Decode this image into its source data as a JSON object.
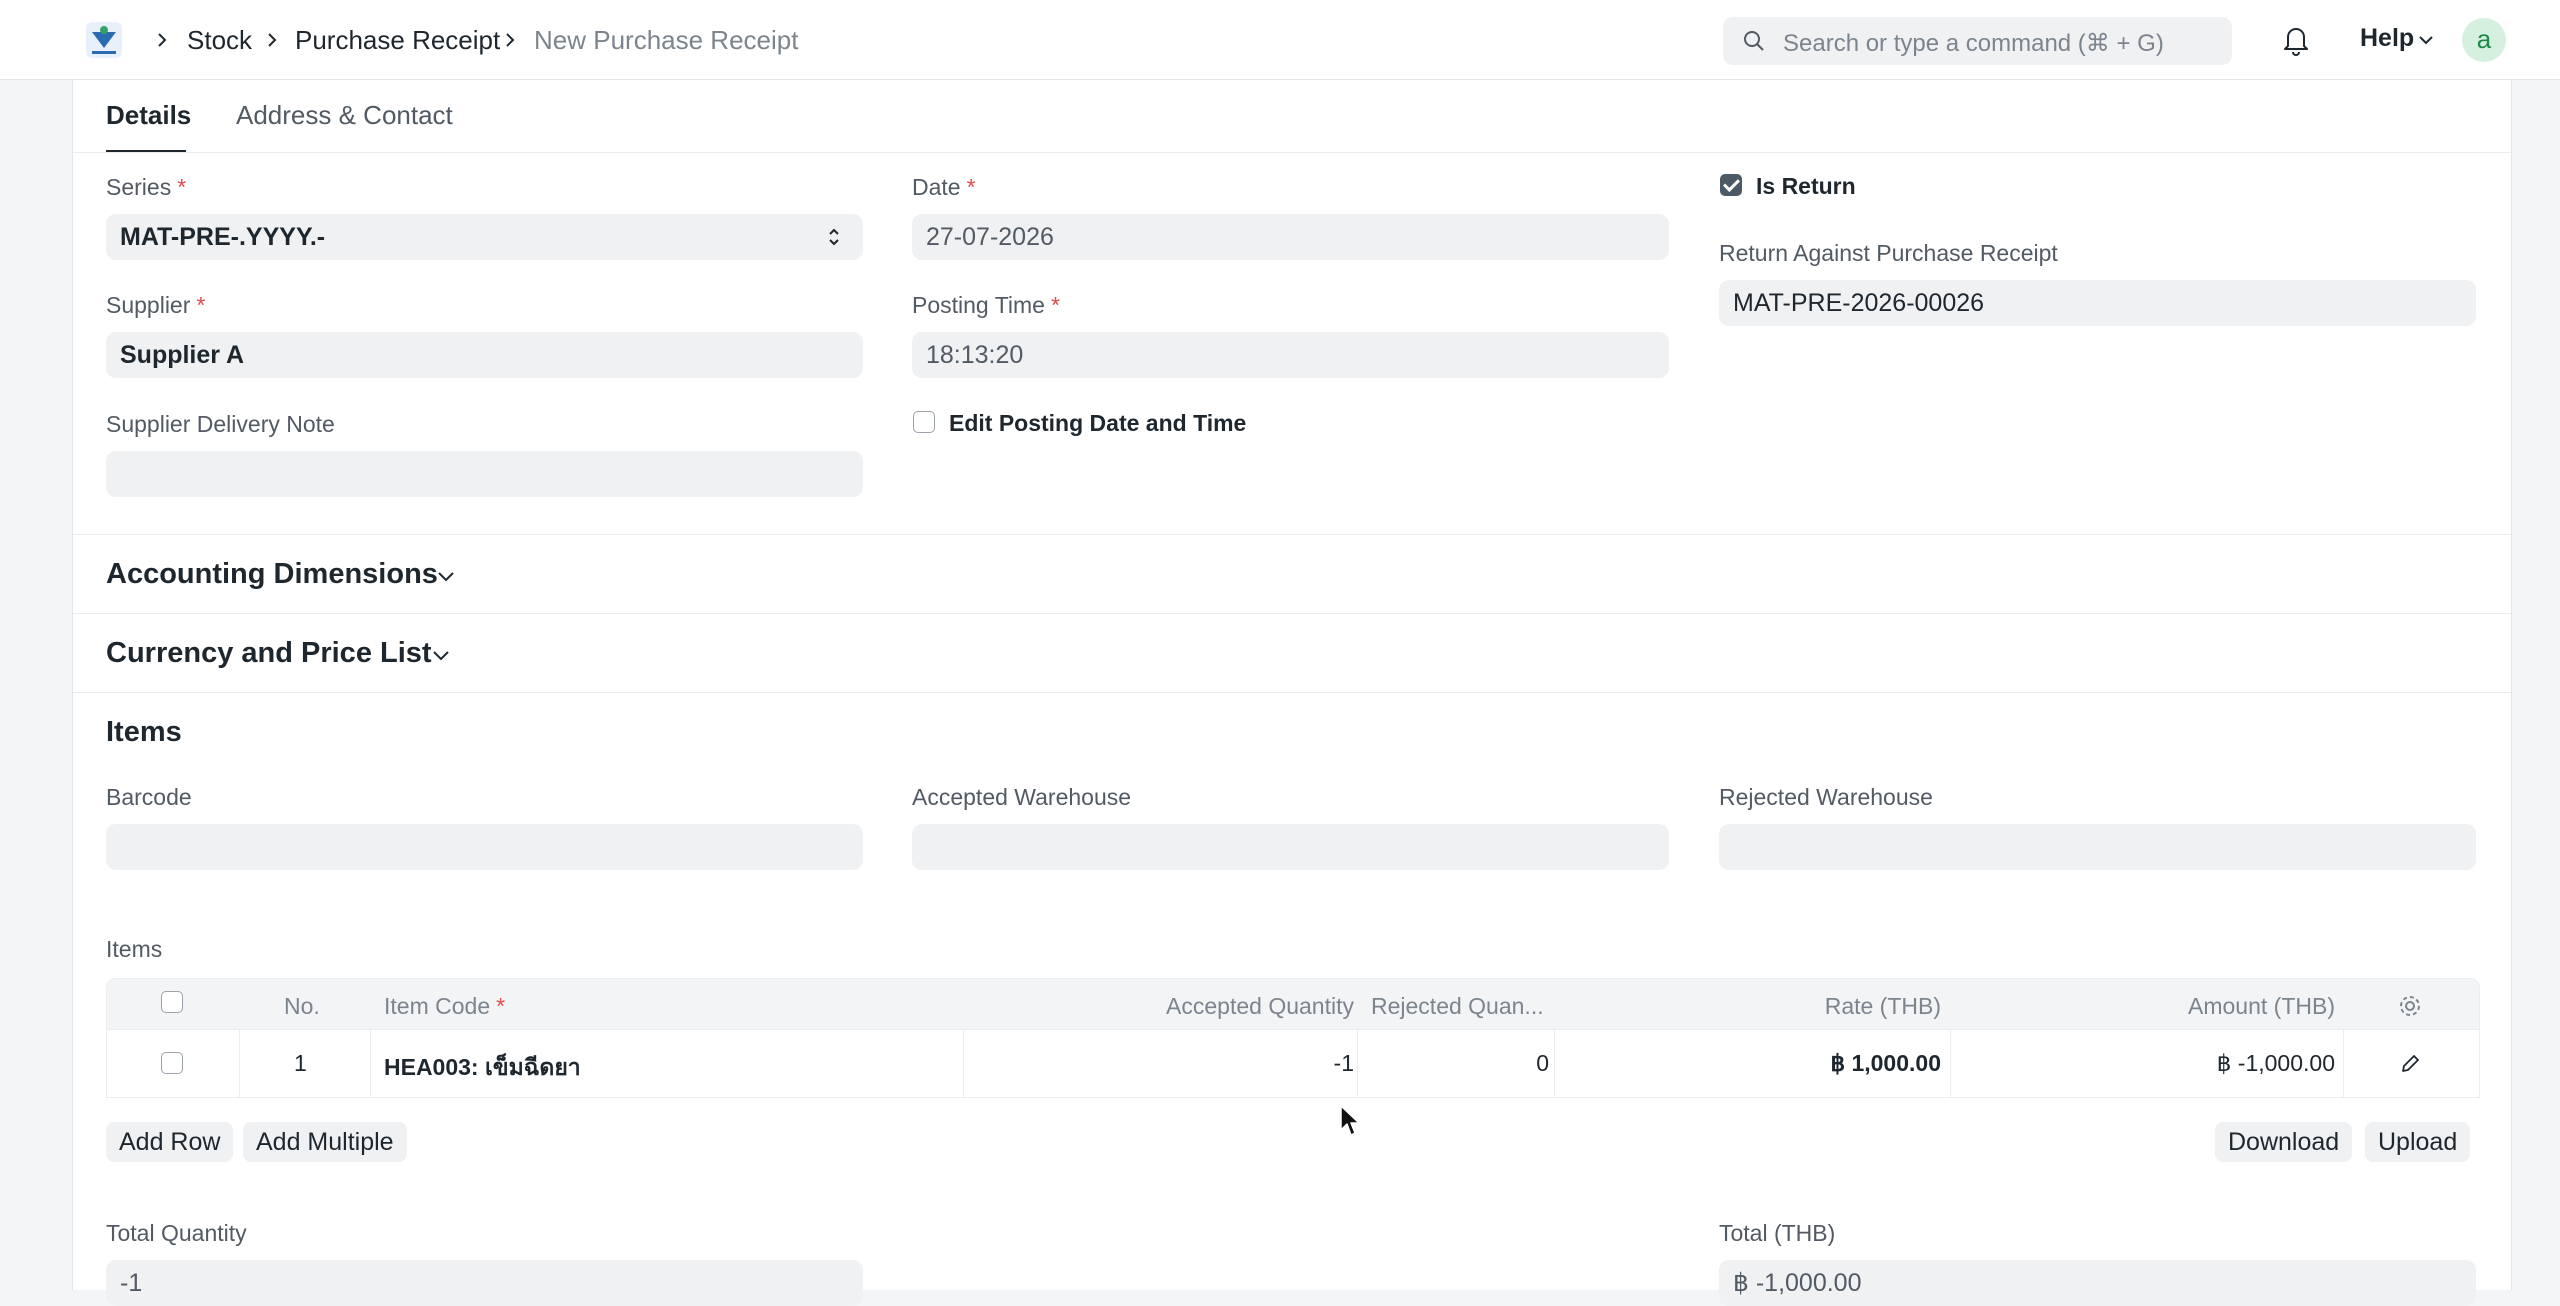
{
  "breadcrumb": {
    "items": [
      "Stock",
      "Purchase Receipt"
    ],
    "current": "New Purchase Receipt"
  },
  "search": {
    "placeholder": "Search or type a command (⌘ + G)"
  },
  "navbar": {
    "help_label": "Help",
    "avatar_letter": "a"
  },
  "tabs": [
    {
      "label": "Details",
      "active": true
    },
    {
      "label": "Address & Contact",
      "active": false
    }
  ],
  "details": {
    "series": {
      "label": "Series",
      "required": "*",
      "value": "MAT-PRE-.YYYY.-"
    },
    "date": {
      "label": "Date",
      "required": "*",
      "value": "27-07-2026"
    },
    "is_return": {
      "label": "Is Return",
      "checked": true
    },
    "return_against": {
      "label": "Return Against Purchase Receipt",
      "value": "MAT-PRE-2026-00026"
    },
    "supplier": {
      "label": "Supplier",
      "required": "*",
      "value": "Supplier A"
    },
    "posting_time": {
      "label": "Posting Time",
      "required": "*",
      "value": "18:13:20"
    },
    "supplier_delivery_note": {
      "label": "Supplier Delivery Note",
      "value": ""
    },
    "edit_posting": {
      "label": "Edit Posting Date and Time",
      "checked": false
    }
  },
  "sections": {
    "accounting_dimensions": "Accounting Dimensions",
    "currency_price_list": "Currency and Price List",
    "items": "Items"
  },
  "items_section": {
    "barcode_label": "Barcode",
    "accepted_warehouse_label": "Accepted Warehouse",
    "rejected_warehouse_label": "Rejected Warehouse",
    "table_label": "Items",
    "columns": {
      "no": "No.",
      "item_code": "Item Code",
      "item_code_required": "*",
      "accepted_qty": "Accepted Quantity",
      "rejected_qty": "Rejected Quan...",
      "rate": "Rate (THB)",
      "amount": "Amount (THB)"
    },
    "rows": [
      {
        "no": "1",
        "item_code": "HEA003: เข็มฉีดยา",
        "accepted_qty": "-1",
        "rejected_qty": "0",
        "rate": "฿ 1,000.00",
        "amount": "฿ -1,000.00"
      }
    ],
    "buttons": {
      "add_row": "Add Row",
      "add_multiple": "Add Multiple",
      "download": "Download",
      "upload": "Upload"
    }
  },
  "totals": {
    "total_quantity_label": "Total Quantity",
    "total_quantity_value": "-1",
    "total_thb_label": "Total (THB)",
    "total_thb_value": "฿ -1,000.00"
  },
  "colors": {
    "required_star": "#e24c4c",
    "checkbox_checked": "#4c5a67",
    "field_bg": "#f0f1f2",
    "avatar_bg": "#d6f0e0"
  }
}
